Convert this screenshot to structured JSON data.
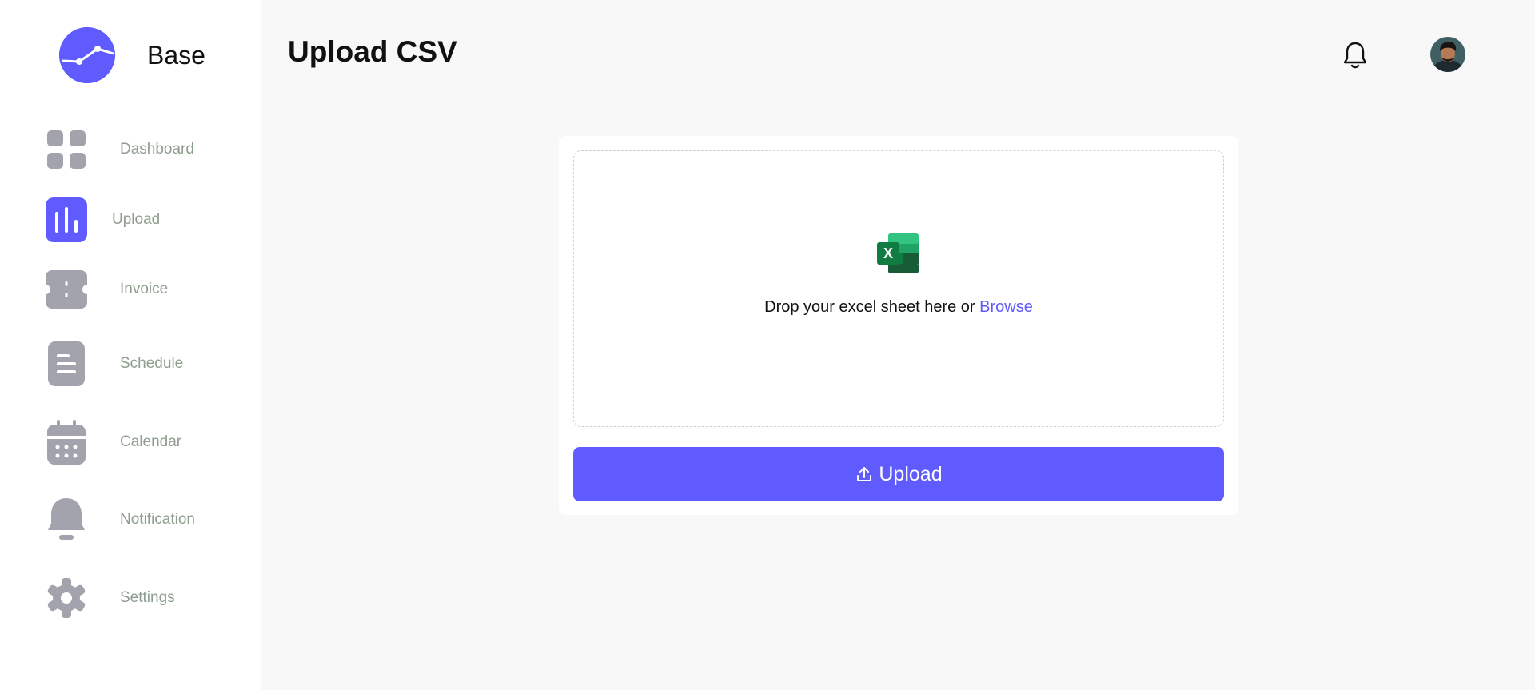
{
  "brand": {
    "name": "Base",
    "accent": "#605bff"
  },
  "sidebar": {
    "items": [
      {
        "label": "Dashboard",
        "icon": "grid-icon",
        "active": false
      },
      {
        "label": "Upload",
        "icon": "bar-chart-icon",
        "active": true
      },
      {
        "label": "Invoice",
        "icon": "ticket-icon",
        "active": false
      },
      {
        "label": "Schedule",
        "icon": "document-icon",
        "active": false
      },
      {
        "label": "Calendar",
        "icon": "calendar-icon",
        "active": false
      },
      {
        "label": "Notification",
        "icon": "bell-icon",
        "active": false
      },
      {
        "label": "Settings",
        "icon": "gear-icon",
        "active": false
      }
    ]
  },
  "header": {
    "title": "Upload CSV",
    "notification_icon": "bell-icon",
    "avatar_icon": "user-avatar"
  },
  "upload": {
    "file_icon": "excel-icon",
    "drop_text": "Drop your excel sheet here or ",
    "browse_label": "Browse",
    "button_label": "Upload",
    "button_icon": "upload-icon"
  },
  "colors": {
    "accent": "#605bff",
    "icon_gray": "#a3a3ae",
    "label_gray": "#8e9e8e",
    "background": "#f8f8f8"
  }
}
